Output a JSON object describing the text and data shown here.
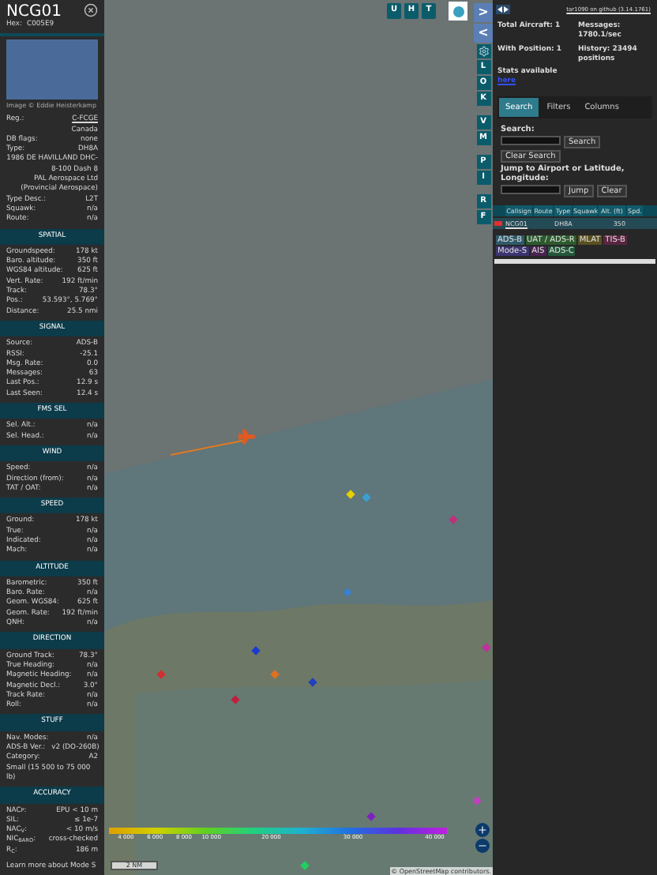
{
  "selected_aircraft": {
    "callsign": "NCG01",
    "hex_label": "Hex:",
    "hex": "C005E9",
    "photo_credit": "Image © Eddie Heisterkamp",
    "details": [
      {
        "kind": "pair",
        "label": "Reg.:",
        "value": "C-FCGE",
        "link": true
      },
      {
        "kind": "line",
        "value": "Canada"
      },
      {
        "kind": "pair",
        "label": "DB flags:",
        "value": "none",
        "link": false
      },
      {
        "kind": "pair",
        "label": "Type:",
        "value": "DH8A",
        "link": false
      },
      {
        "kind": "line",
        "value": "1986 DE HAVILLAND DHC-8-100 Dash 8"
      },
      {
        "kind": "line",
        "value": "PAL Aerospace Ltd (Provincial Aerospace)"
      },
      {
        "kind": "pair",
        "label": "Type Desc.:",
        "value": "L2T",
        "link": false
      },
      {
        "kind": "pair",
        "label": "Squawk:",
        "value": "n/a",
        "link": false
      },
      {
        "kind": "pair",
        "label": "Route:",
        "value": "n/a",
        "link": false
      }
    ],
    "sections": [
      {
        "title": "SPATIAL",
        "rows": [
          {
            "label": "Groundspeed:",
            "value": "178 kt"
          },
          {
            "label": "Baro. altitude:",
            "value": "350 ft"
          },
          {
            "label": "WGS84 altitude:",
            "value": "625 ft"
          },
          {
            "label": "Vert. Rate:",
            "value": "192 ft/min"
          },
          {
            "label": "Track:",
            "value": "78.3°"
          },
          {
            "label": "Pos.:",
            "value": "53.593°, 5.769°"
          },
          {
            "label": "Distance:",
            "value": "25.5 nmi"
          }
        ]
      },
      {
        "title": "SIGNAL",
        "rows": [
          {
            "label": "Source:",
            "value": "ADS-B"
          },
          {
            "label": "RSSI:",
            "value": "-25.1"
          },
          {
            "label": "Msg. Rate:",
            "value": "0.0"
          },
          {
            "label": "Messages:",
            "value": "63"
          },
          {
            "label": "Last Pos.:",
            "value": "12.9 s"
          },
          {
            "label": "Last Seen:",
            "value": "12.4 s"
          }
        ]
      },
      {
        "title": "FMS SEL",
        "rows": [
          {
            "label": "Sel. Alt.:",
            "value": "n/a"
          },
          {
            "label": "Sel. Head.:",
            "value": "n/a"
          }
        ]
      },
      {
        "title": "WIND",
        "rows": [
          {
            "label": "Speed:",
            "value": "n/a"
          },
          {
            "label": "Direction (from):",
            "value": "n/a"
          },
          {
            "label": "TAT / OAT:",
            "value": "n/a"
          }
        ]
      },
      {
        "title": "SPEED",
        "rows": [
          {
            "label": "Ground:",
            "value": "178 kt"
          },
          {
            "label": "True:",
            "value": "n/a"
          },
          {
            "label": "Indicated:",
            "value": "n/a"
          },
          {
            "label": "Mach:",
            "value": "n/a"
          }
        ]
      },
      {
        "title": "ALTITUDE",
        "rows": [
          {
            "label": "Barometric:",
            "value": "350 ft"
          },
          {
            "label": "Baro. Rate:",
            "value": "n/a"
          },
          {
            "label": "Geom. WGS84:",
            "value": "625 ft"
          },
          {
            "label": "Geom. Rate:",
            "value": "192 ft/min"
          },
          {
            "label": "QNH:",
            "value": "n/a"
          }
        ]
      },
      {
        "title": "DIRECTION",
        "rows": [
          {
            "label": "Ground Track:",
            "value": "78.3°"
          },
          {
            "label": "True Heading:",
            "value": "n/a"
          },
          {
            "label": "Magnetic Heading:",
            "value": "n/a"
          },
          {
            "label": "Magnetic Decl.:",
            "value": "3.0°"
          },
          {
            "label": "Track Rate:",
            "value": "n/a"
          },
          {
            "label": "Roll:",
            "value": "n/a"
          }
        ]
      },
      {
        "title": "STUFF",
        "rows": [
          {
            "label": "Nav. Modes:",
            "value": "n/a"
          },
          {
            "label": "ADS-B Ver.:",
            "value": "v2 (DO-260B)"
          },
          {
            "label": "Category:",
            "value": "A2"
          },
          {
            "label": "Small (15 500 to 75 000 lb)"
          }
        ]
      },
      {
        "title": "ACCURACY",
        "rows": [
          {
            "label": "NAC$_{P}$:",
            "value": "EPU < 10 m"
          },
          {
            "label": "SIL:",
            "value": "≤ 1e-7"
          },
          {
            "label": "NAC$_{V}$:",
            "value": "< 10 m/s"
          },
          {
            "label": "NIC$_{BARO}$:",
            "value": "cross-checked"
          },
          {
            "label": "R$_{C}$:",
            "value": "186 m"
          }
        ]
      }
    ],
    "footer": "Learn more about Mode S"
  },
  "map": {
    "top_buttons": [
      "U",
      "H",
      "T"
    ],
    "side_buttons": [
      {
        "kind": "arrow",
        "label": ">"
      },
      {
        "kind": "arrow",
        "label": "<"
      },
      {
        "kind": "gear"
      },
      {
        "kind": "letter",
        "label": "L"
      },
      {
        "kind": "letter",
        "label": "O"
      },
      {
        "kind": "letter",
        "label": "K"
      },
      {
        "kind": "gap"
      },
      {
        "kind": "letter",
        "label": "V"
      },
      {
        "kind": "letter",
        "label": "M"
      },
      {
        "kind": "gap"
      },
      {
        "kind": "letter",
        "label": "P"
      },
      {
        "kind": "letter",
        "label": "I"
      },
      {
        "kind": "gap"
      },
      {
        "kind": "letter",
        "label": "R"
      },
      {
        "kind": "letter",
        "label": "F"
      }
    ],
    "altitude_legend": [
      "4 000",
      "6 000",
      "8 000",
      "10 000",
      "20 000",
      "30 000",
      "40 000"
    ],
    "scale": "2 NM",
    "attribution": "© OpenStreetMap contributors."
  },
  "sidebar": {
    "version_link": "tar1090 on github (3.14.1761)",
    "stats": [
      {
        "label": "Total Aircraft: 1"
      },
      {
        "label": "Messages: 1780.1/sec"
      },
      {
        "label": "With Position: 1"
      },
      {
        "label": "History: 23494 positions"
      }
    ],
    "stats_note": "Stats available",
    "stats_link": "here",
    "tabs": [
      {
        "label": "Search",
        "selected": true
      },
      {
        "label": "Filters",
        "selected": false
      },
      {
        "label": "Columns",
        "selected": false
      }
    ],
    "search_label": "Search:",
    "search_button": "Search",
    "clear_search": "Clear Search",
    "jump_label": "Jump to Airport or Latitude, Longitude:",
    "jump_button": "Jump",
    "clear_button": "Clear",
    "table": {
      "columns": [
        "Callsign",
        "Route",
        "Type",
        "Squawk",
        "Alt. (ft)",
        "Spd."
      ],
      "rows": [
        {
          "callsign": "NCG01",
          "route": "",
          "type": "DH8A",
          "squawk": "",
          "alt": "350",
          "spd": ""
        }
      ]
    },
    "sources": [
      {
        "label": "ADS-B",
        "color": "#2f5a6a"
      },
      {
        "label": "UAT / ADS-R",
        "color": "#2c5a2e"
      },
      {
        "label": "MLAT",
        "color": "#5a5020"
      },
      {
        "label": "TIS-B",
        "color": "#5a2440"
      },
      {
        "label": "Mode-S",
        "color": "#3a3470"
      },
      {
        "label": "AIS",
        "color": "#4a2452"
      },
      {
        "label": "ADS-C",
        "color": "#24583a"
      }
    ]
  }
}
